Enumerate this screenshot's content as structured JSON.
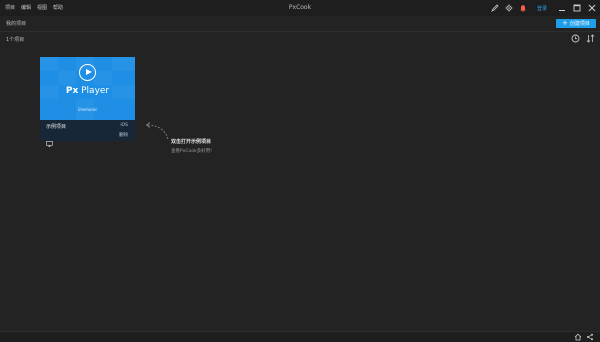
{
  "menu": [
    {
      "label": "项目"
    },
    {
      "label": "编辑"
    },
    {
      "label": "视图"
    },
    {
      "label": "帮助"
    }
  ],
  "app_title": "PxCook",
  "header": {
    "login_label": "登录",
    "icons": [
      "pen-icon",
      "settings-icon",
      "notification-icon"
    ]
  },
  "window_controls": [
    "minimize-icon",
    "maximize-icon",
    "close-icon"
  ],
  "subbar": {
    "page_title": "我的项目",
    "create_button_label": "创建项目"
  },
  "project_count_text": "1个项目",
  "toolbar_icons": [
    "clock-icon",
    "sort-icon"
  ],
  "project_card": {
    "thumbnail_title_prefix": "Px",
    "thumbnail_title_suffix": " Player",
    "thumbnail_subtitle": "Usemonic",
    "name": "示例项目",
    "platform": "iOS",
    "delete_label": "删除"
  },
  "hint": {
    "title": "双击打开示例项目",
    "subtitle": "查看PxCook多好用!"
  },
  "colors": {
    "accent": "#1e9de8",
    "background": "#232323",
    "titlebar": "#1e1e1e",
    "card_thumb": "#1f8fe6",
    "card_info": "#182738"
  }
}
